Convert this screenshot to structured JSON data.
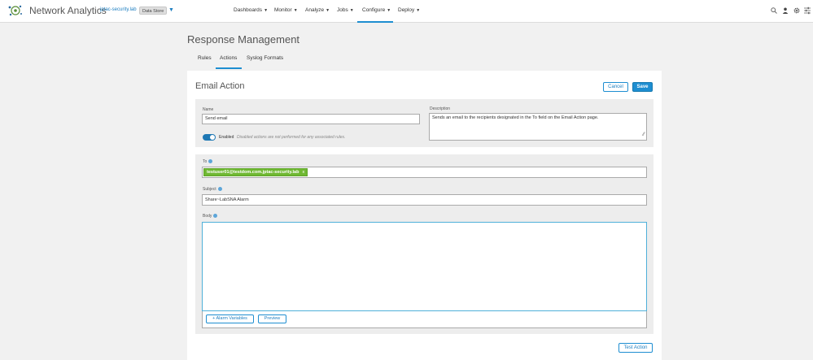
{
  "app": {
    "title": "Network Analytics",
    "domain": "jptac-security.lab",
    "data_store": "Data Store",
    "data_store_caret": "▼"
  },
  "nav": [
    {
      "label": "Dashboards",
      "caret": "▼",
      "active": false
    },
    {
      "label": "Monitor",
      "caret": "▼",
      "active": false
    },
    {
      "label": "Analyze",
      "caret": "▼",
      "active": false
    },
    {
      "label": "Jobs",
      "caret": "▼",
      "active": false
    },
    {
      "label": "Configure",
      "caret": "▼",
      "active": true
    },
    {
      "label": "Deploy",
      "caret": "▼",
      "active": false
    }
  ],
  "top_icons": [
    "search-icon",
    "user-icon",
    "gear-icon",
    "sliders-icon"
  ],
  "page": {
    "title": "Response Management"
  },
  "tabs": [
    {
      "label": "Rules",
      "active": false
    },
    {
      "label": "Actions",
      "active": true
    },
    {
      "label": "Syslog Formats",
      "active": false
    }
  ],
  "form": {
    "title": "Email Action",
    "cancel_label": "Cancel",
    "save_label": "Save",
    "name_label": "Name",
    "name_value": "Send email",
    "description_label": "Description",
    "description_value": "Sends an email to the recipients designated in the To field on the Email Action page.",
    "enabled_label": "Enabled",
    "enabled_help": "Disabled actions are not performed for any associated rules.",
    "enabled": true,
    "to_label": "To",
    "to_recipients": [
      "testuser01@testdom.com.jptac-security.lab"
    ],
    "chip_remove": "x",
    "subject_label": "Subject",
    "subject_value": "Share~LabSNA Alarm",
    "body_label": "Body",
    "body_value": "",
    "alarm_variables_label": "+ Alarm Variables",
    "preview_label": "Preview",
    "test_action_label": "Test Action"
  },
  "colors": {
    "accent": "#1e8ed1",
    "save_bg": "#1e8ed1",
    "chip_green": "#6fb832",
    "toggle_on": "#1e78b4"
  }
}
